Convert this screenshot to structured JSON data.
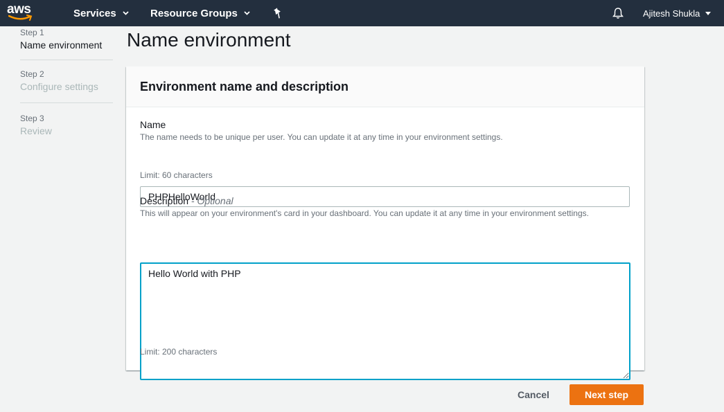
{
  "nav": {
    "logo": "aws",
    "services_label": "Services",
    "resource_groups_label": "Resource Groups",
    "user_name": "Ajitesh Shukla",
    "colors": {
      "bg": "#232f3e",
      "text": "#ffffff"
    },
    "icons": [
      "chevron-down-icon",
      "pin-icon",
      "bell-icon"
    ]
  },
  "steps": [
    {
      "number": "Step 1",
      "name": "Name environment",
      "active": true
    },
    {
      "number": "Step 2",
      "name": "Configure settings",
      "active": false
    },
    {
      "number": "Step 3",
      "name": "Review",
      "active": false
    }
  ],
  "page": {
    "title": "Name environment"
  },
  "card": {
    "title": "Environment name and description",
    "name_field": {
      "label": "Name",
      "description": "The name needs to be unique per user. You can update it at any time in your environment settings.",
      "value": "PHPHelloWorld",
      "limit": "Limit: 60 characters"
    },
    "description_field": {
      "label": "Description",
      "optional": "- Optional",
      "description": "This will appear on your environment's card in your dashboard. You can update it at any time in your environment settings.",
      "value": "Hello World with PHP",
      "limit": "Limit: 200 characters"
    }
  },
  "actions": {
    "cancel_label": "Cancel",
    "next_label": "Next step",
    "accent_color": "#ec7211"
  }
}
